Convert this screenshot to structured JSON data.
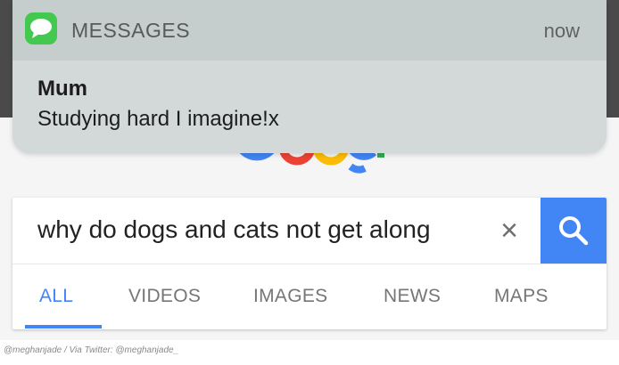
{
  "notification": {
    "app_name": "MESSAGES",
    "time": "now",
    "sender": "Mum",
    "message": "Studying hard I imagine!x",
    "app_icon": "messages-app-icon"
  },
  "search": {
    "query": "why do dogs and cats not get along",
    "clear_icon": "×",
    "search_icon": "magnifier-icon",
    "logo": "Google"
  },
  "tabs": [
    {
      "label": "ALL",
      "active": true
    },
    {
      "label": "VIDEOS",
      "active": false
    },
    {
      "label": "IMAGES",
      "active": false
    },
    {
      "label": "NEWS",
      "active": false
    },
    {
      "label": "MAPS",
      "active": false
    }
  ],
  "caption": "@meghanjade / Via Twitter: @meghanjade_",
  "colors": {
    "accent": "#4285f4",
    "messages_green": "#43c94f",
    "notification_bg": "#d3d8d8"
  }
}
